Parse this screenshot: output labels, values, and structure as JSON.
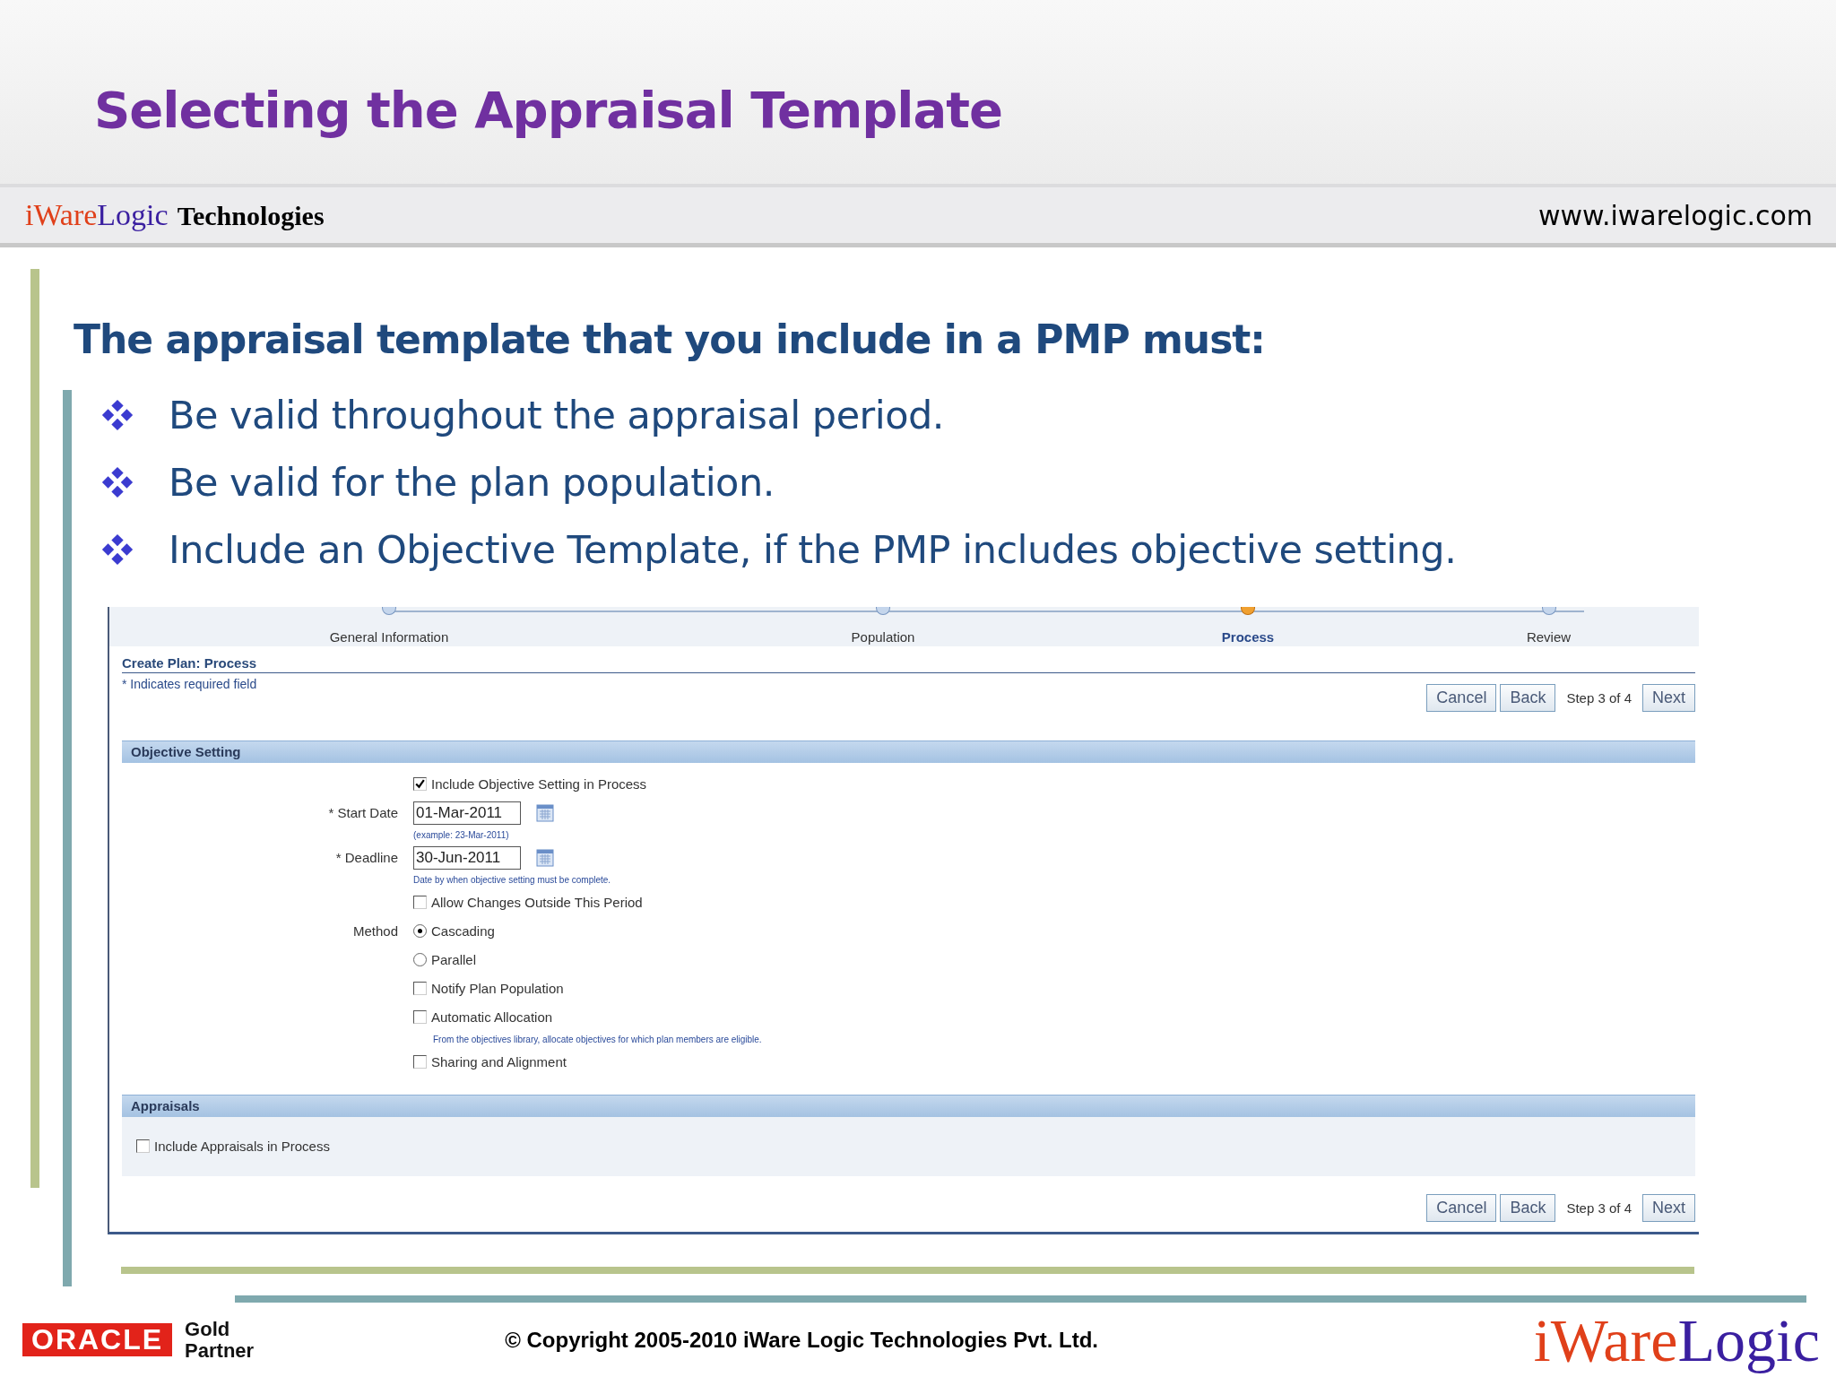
{
  "slide_title": "Selecting the Appraisal Template",
  "brand": {
    "logo_part_1": "iWare",
    "logo_part_2": "Logic",
    "company": "Technologies",
    "url": "www.iwarelogic.com"
  },
  "heading": "The appraisal template that you include in a PMP must:",
  "bullets": [
    "Be valid throughout the appraisal period.",
    "Be valid for the plan population.",
    "Include an Objective Template, if the PMP includes objective setting."
  ],
  "app": {
    "train": [
      {
        "label": "General Information",
        "selected": false
      },
      {
        "label": "Population",
        "selected": false
      },
      {
        "label": "Process",
        "selected": true
      },
      {
        "label": "Review",
        "selected": false
      }
    ],
    "page_title": "Create Plan: Process",
    "required_note": "* Indicates required field",
    "top_actions": [
      {
        "kind": "button",
        "text": "Cancel"
      },
      {
        "kind": "button",
        "text": "Back"
      },
      {
        "kind": "text",
        "text": "Step 3 of 4"
      },
      {
        "kind": "button",
        "text": "Next"
      }
    ],
    "objective_section": {
      "title": "Objective Setting",
      "rows": [
        {
          "kind": "checkbox",
          "text": "Include Objective Setting in Process",
          "checked": true
        },
        {
          "kind": "date",
          "label": "* Start Date",
          "value": "01-Mar-2011",
          "hint": "(example: 23-Mar-2011)"
        },
        {
          "kind": "date",
          "label": "* Deadline",
          "value": "30-Jun-2011",
          "hint": "Date by when objective setting must be complete."
        },
        {
          "kind": "checkbox",
          "text": "Allow Changes Outside This Period",
          "checked": false
        },
        {
          "kind": "radio",
          "label": "Method",
          "text": "Cascading",
          "selected": true
        },
        {
          "kind": "radio",
          "text": "Parallel",
          "selected": false
        },
        {
          "kind": "checkbox",
          "text": "Notify Plan Population",
          "checked": false
        },
        {
          "kind": "checkbox",
          "text": "Automatic Allocation",
          "checked": false,
          "hint": "From the objectives library, allocate objectives for which plan members are eligible."
        },
        {
          "kind": "checkbox",
          "text": "Sharing and Alignment",
          "checked": false
        }
      ]
    },
    "appraisals_section": {
      "title": "Appraisals",
      "checkbox": {
        "text": "Include Appraisals in Process",
        "checked": false
      }
    },
    "bottom_actions": [
      {
        "kind": "button",
        "text": "Cancel"
      },
      {
        "kind": "button",
        "text": "Back"
      },
      {
        "kind": "text",
        "text": "Step 3 of 4"
      },
      {
        "kind": "button",
        "text": "Next"
      }
    ]
  },
  "footer": {
    "partner_logo": "ORACLE",
    "partner_level": "Gold",
    "partner_word": "Partner",
    "copyright": "© Copyright 2005-2010 iWare Logic Technologies Pvt. Ltd.",
    "logo_part_1": "iWare",
    "logo_part_2": "Logic"
  }
}
